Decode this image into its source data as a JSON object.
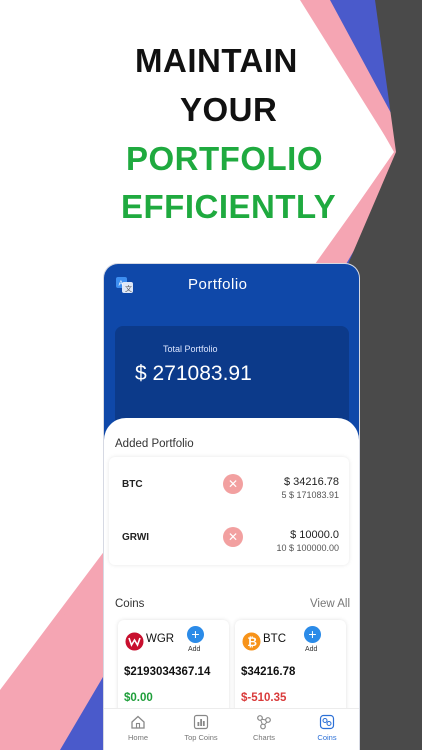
{
  "headline": {
    "line1": "MAINTAIN",
    "line2": "YOUR",
    "line3": "PORTFOLIO",
    "line4": "EFFICIENTLY"
  },
  "colors": {
    "headline_dark": "#111111",
    "headline_green": "#1faa3f",
    "primary_blue": "#0f48a9",
    "delete_red": "#f2a0a0",
    "add_blue": "#2b8be8",
    "positive_green": "#1e9e3a",
    "negative_red": "#d93a3a"
  },
  "app": {
    "title": "Portfolio",
    "translate_icon": "translate-icon",
    "total": {
      "label": "Total Portfolio",
      "value": "$ 271083.91"
    },
    "added_portfolio": {
      "title": "Added Portfolio",
      "items": [
        {
          "symbol": "BTC",
          "amount": "$ 34216.78",
          "detail": "5 $ 171083.91"
        },
        {
          "symbol": "GRWI",
          "amount": "$ 10000.0",
          "detail": "10 $ 100000.00"
        }
      ]
    },
    "coins": {
      "title": "Coins",
      "view_all": "View All",
      "add_label": "Add",
      "items": [
        {
          "name": "WGR",
          "price": "$2193034367.14",
          "change": "$0.00",
          "change_dir": "up",
          "icon": "wgr-logo-icon"
        },
        {
          "name": "BTC",
          "price": "$34216.78",
          "change": "$-510.35",
          "change_dir": "down",
          "icon": "bitcoin-logo-icon"
        }
      ]
    },
    "nav": [
      {
        "label": "Home",
        "icon": "home-icon",
        "active": false
      },
      {
        "label": "Top Coins",
        "icon": "bar-chart-icon",
        "active": false
      },
      {
        "label": "Charts",
        "icon": "network-chart-icon",
        "active": false
      },
      {
        "label": "Coins",
        "icon": "coins-icon",
        "active": true
      }
    ]
  }
}
